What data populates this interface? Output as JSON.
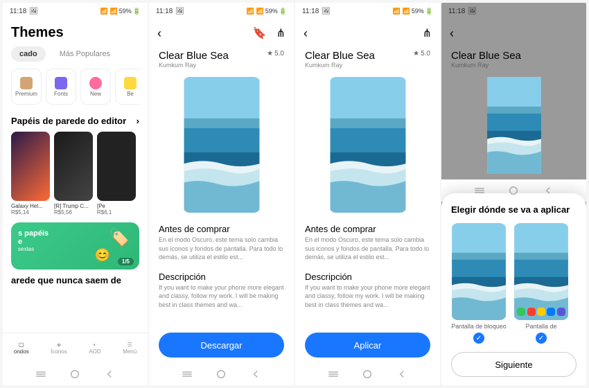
{
  "status": {
    "time": "11:18",
    "battery": "59%",
    "photo_icon": "🖼"
  },
  "screen1": {
    "title": "Themes",
    "tabs": [
      "cado",
      "Más Populares"
    ],
    "cats": [
      {
        "label": "Premium",
        "color": "#d4a574"
      },
      {
        "label": "Fonts",
        "color": "#7b68ee"
      },
      {
        "label": "New",
        "color": "#ff6b9d"
      },
      {
        "label": "Be",
        "color": "#ffd93d"
      }
    ],
    "section1_title": "Papéis de parede do editor",
    "items": [
      {
        "name": "Galaxy Hel...",
        "price": "R$5,14",
        "bg": "linear-gradient(135deg,#2a1a4a,#ff6b35)"
      },
      {
        "name": "[R] Trump C...",
        "price": "R$5,56",
        "bg": "linear-gradient(135deg,#1a1a1a,#444)"
      },
      {
        "name": "[Pe",
        "price": "R$6,1",
        "bg": "#222"
      }
    ],
    "banner_line1": "s papéis",
    "banner_line2": "e",
    "banner_line3": "sextas",
    "banner_badge": "1/5",
    "section2_title": "arede que nunca saem de",
    "bottom": [
      {
        "label": "ondos",
        "active": true
      },
      {
        "label": "Íconos",
        "active": false
      },
      {
        "label": "AOD",
        "active": false
      },
      {
        "label": "Menú",
        "active": false
      }
    ]
  },
  "detail": {
    "title": "Clear Blue Sea",
    "author": "Kumkum Ray",
    "rating": "5.0",
    "before_buy_h": "Antes de comprar",
    "before_buy_p": "En el modo Oscuro, este tema solo cambia sus iconos y fondos de pantalla. Para todo lo demás, se utiliza el estilo est...",
    "desc_h": "Descripción",
    "desc_p": "If you want to make your phone more elegant and classy, follow my work. I will be making best in class themes and wa..."
  },
  "screen2": {
    "button": "Descargar"
  },
  "screen3": {
    "button": "Aplicar"
  },
  "screen4": {
    "modal_title": "Elegir dónde se va a aplicar",
    "opts": [
      {
        "label": "Pantalla de bloqueo",
        "checked": true,
        "home": false
      },
      {
        "label": "Pantalla de",
        "checked": true,
        "home": true
      }
    ],
    "next": "Siguiente"
  }
}
